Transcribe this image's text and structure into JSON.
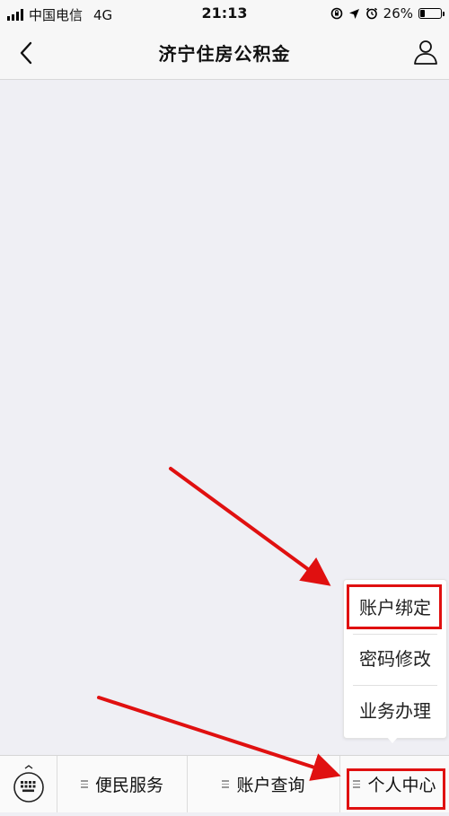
{
  "status_bar": {
    "carrier": "中国电信",
    "network": "4G",
    "time": "21:13",
    "battery": "26%",
    "battery_level": 0.26
  },
  "nav": {
    "title": "济宁住房公积金",
    "back_icon": "chevron-left-icon",
    "user_icon": "person-icon"
  },
  "submenu": {
    "items": [
      "账户绑定",
      "密码修改",
      "业务办理"
    ]
  },
  "bottom_menu": {
    "keyboard_icon": "keyboard-icon",
    "tabs": [
      "便民服务",
      "账户查询",
      "个人中心"
    ]
  },
  "colors": {
    "annotation_red": "#e01010",
    "background": "#efeff4"
  }
}
